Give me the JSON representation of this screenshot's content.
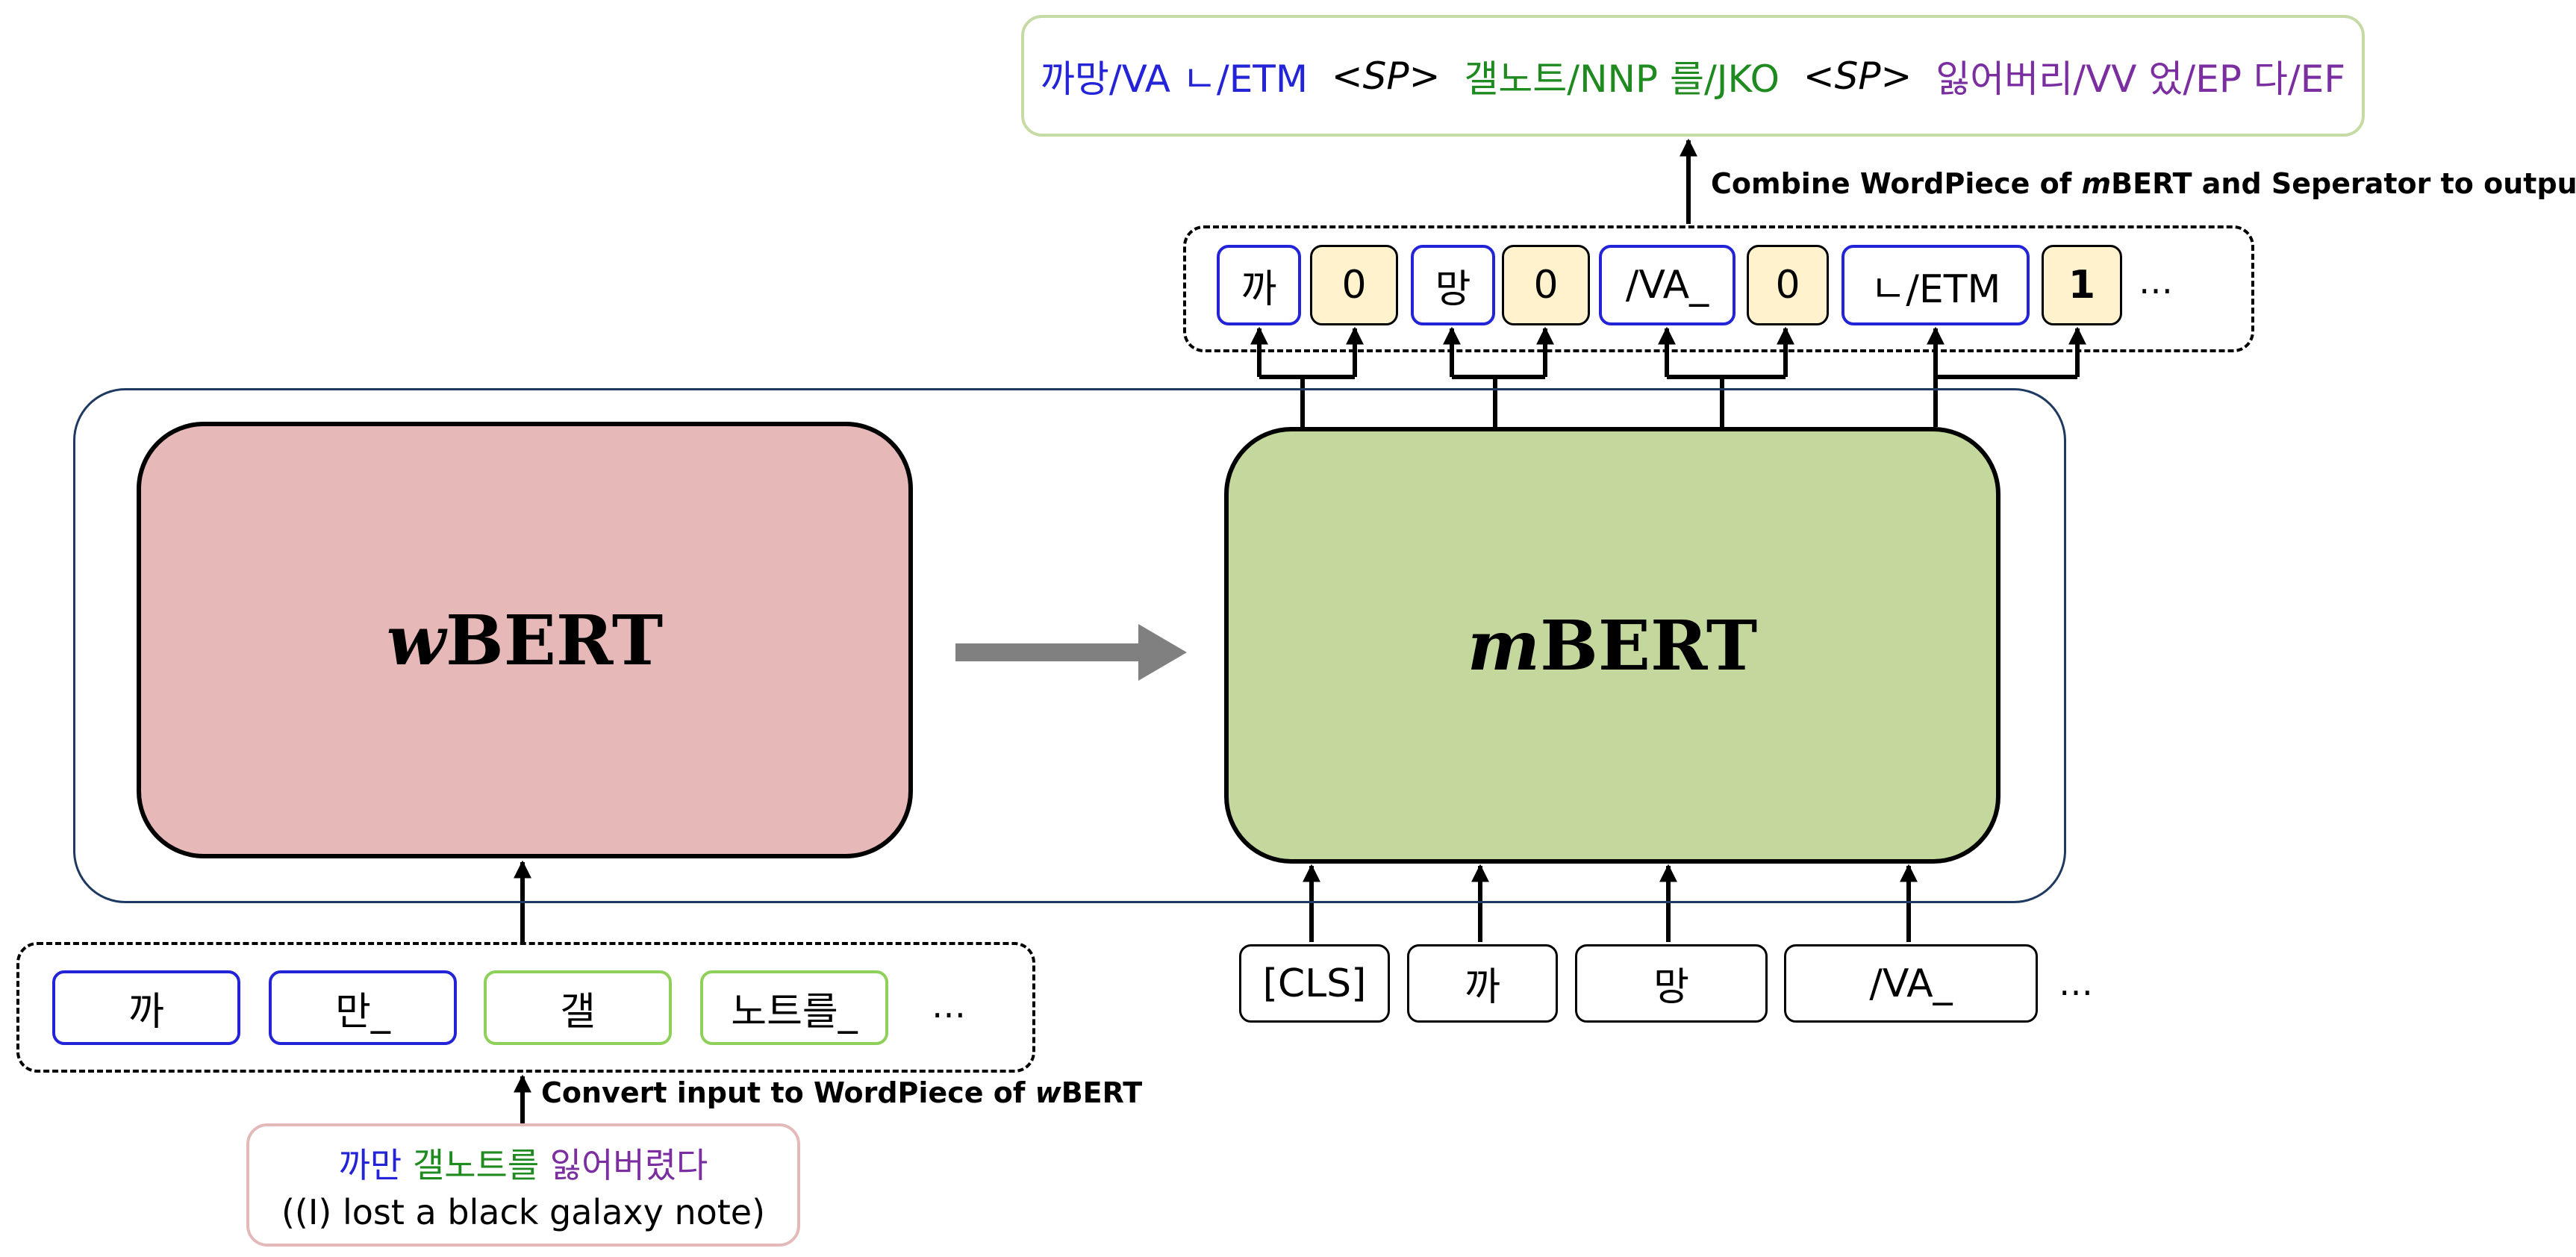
{
  "models": {
    "w_prefix": "w",
    "w_name": "BERT",
    "m_prefix": "m",
    "m_name": "BERT"
  },
  "input_sentence": {
    "ko_part1": "까만",
    "ko_part2": "갤노트를",
    "ko_part3": "잃어버렸다",
    "english": "((I) lost a black galaxy note)"
  },
  "captions": {
    "convert_prefix": "Convert input to WordPiece of ",
    "convert_italic": "w",
    "convert_suffix": "BERT",
    "combine_prefix": "Combine WordPiece of ",
    "combine_italic": "m",
    "combine_suffix": "BERT and Seperator to output"
  },
  "wbert_input_tokens": [
    "까",
    "만_",
    "갤",
    "노트를_"
  ],
  "wbert_input_ellipsis": "…",
  "mbert_input_tokens": [
    "[CLS]",
    "까",
    "망",
    "/VA_"
  ],
  "mbert_input_ellipsis": "…",
  "output_tokens": [
    "까",
    "0",
    "망",
    "0",
    "/VA_",
    "0",
    "ㄴ/ETM",
    "1"
  ],
  "output_ellipsis": "…",
  "output_sequence": {
    "seg1": "까망/VA ㄴ/ETM",
    "sp1": "<SP>",
    "seg2": "갤노트/NNP 를/JKO",
    "sp2": "<SP>",
    "seg3": "잃어버리/VV 었/EP 다/EF"
  },
  "colors": {
    "blue": "#2323d8",
    "green": "#1f8a1f",
    "purple": "#7a2ea0",
    "wbert_fill": "#e6b8b8",
    "mbert_fill": "#c4d89e",
    "separator_fill": "#fff2cc",
    "big_arrow": "#808080"
  }
}
